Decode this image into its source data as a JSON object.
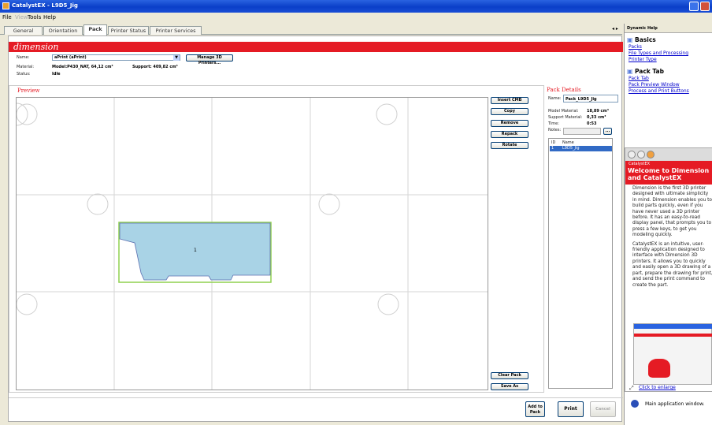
{
  "window": {
    "title": "CatalystEX - L9D5_Jig"
  },
  "menu": {
    "file": "File",
    "view": "View",
    "tools": "Tools",
    "help": "Help"
  },
  "tabs": [
    {
      "label": "General"
    },
    {
      "label": "Orientation"
    },
    {
      "label": "Pack"
    },
    {
      "label": "Printer Status"
    },
    {
      "label": "Printer Services"
    }
  ],
  "logo": "dimension",
  "info": {
    "name_label": "Name:",
    "name_value": "aPrint (aPrint)",
    "manage_label": "Manage 3D Printers...",
    "material_label": "Material:",
    "material_value": "Model:P430_NAT, 64,12 cm³",
    "support_value": "Support: 409,82 cm³",
    "status_label": "Status:",
    "status_value": "Idle"
  },
  "preview": {
    "title": "Preview",
    "part_label": "1"
  },
  "actions": {
    "insert": "Insert CMB",
    "copy": "Copy",
    "remove": "Remove",
    "repack": "Repack",
    "rotate": "Rotate",
    "clear": "Clear Pack",
    "saveas": "Save As"
  },
  "details": {
    "title": "Pack Details",
    "name_label": "Name:",
    "name_value": "Pack_L9D5_Jig",
    "model_label": "Model Material:",
    "model_value": "18,89 cm³",
    "support_label": "Support Material:",
    "support_value": "0,33 cm³",
    "time_label": "Time:",
    "time_value": "0:53",
    "notes_label": "Notes:",
    "browse": "...",
    "col_id": "ID",
    "col_name": "Name",
    "row_id": "1",
    "row_name": "L9D5_Jig"
  },
  "bottom": {
    "add": "Add to Pack",
    "print": "Print",
    "cancel": "Cancel"
  },
  "help": {
    "header": "Dynamic Help",
    "basics": "Basics",
    "links1": [
      "Packs",
      "File Types and Processing",
      "Printer Type"
    ],
    "packtab": "Pack Tab",
    "links2": [
      "Pack Tab",
      "Pack Preview Window",
      "Process and Print Buttons"
    ],
    "popup_small": "CatalystEX",
    "popup_title": "Welcome to Dimension and CatalystEX",
    "p1": "Dimension is the first 3D printer designed with ultimate simplicity in mind. Dimension enables you to build parts quickly, even if you have never used a 3D printer before. It has an easy-to-read display panel, that prompts you to press a few keys, to get you modeling quickly.",
    "p2": "CatalystEX is an intuitive, user-friendly application designed to interface with Dimension 3D printers. It allows you to quickly and easily open a 3D drawing of a part, prepare the drawing for print, and send the print command to create the part.",
    "enlarge": "Click to enlarge",
    "main": "Main application window."
  },
  "colors": {
    "brand_red": "#e51b24",
    "part_fill": "#a9d3e6",
    "part_border": "#8fd14f",
    "selection": "#316ac5"
  }
}
